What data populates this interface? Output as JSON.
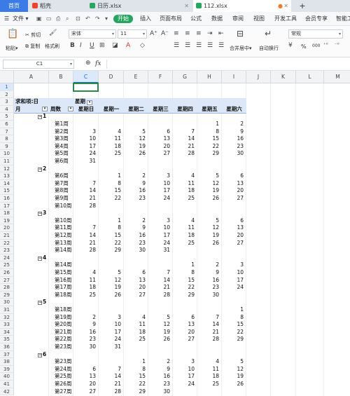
{
  "tabs": {
    "home": "首页",
    "tab1": "稻壳",
    "tab2": "日历.xlsx",
    "tab3": "112.xlsx",
    "new": "+"
  },
  "menu": {
    "file": "文件",
    "items": [
      "开始",
      "插入",
      "页面布局",
      "公式",
      "数据",
      "审阅",
      "视图",
      "开发工具",
      "会员专享",
      "智能工"
    ]
  },
  "ribbon": {
    "paste": "粘贴",
    "cut": "剪切",
    "copy": "复制",
    "format_painter": "格式刷",
    "font_name": "宋体",
    "font_size": "11",
    "merge_center": "合并居中",
    "wrap_text": "自动换行",
    "number_format": "常规",
    "percent": "%",
    "thousands": "000"
  },
  "formula_bar": {
    "cell_ref": "C1",
    "fx": "fx",
    "value": ""
  },
  "columns": [
    "A",
    "B",
    "C",
    "D",
    "E",
    "F",
    "G",
    "H",
    "I",
    "J",
    "K",
    "L",
    "M"
  ],
  "selected_column": "C",
  "selected_row": "1",
  "pivot": {
    "summary_label": "求和项:日",
    "col_field": "星期",
    "row_field_month": "月",
    "row_field_week": "周数",
    "weekdays": [
      "星期日",
      "星期一",
      "星期二",
      "星期三",
      "星期四",
      "星期五",
      "星期六"
    ]
  },
  "rows": [
    {
      "r": "1"
    },
    {
      "r": "2"
    },
    {
      "r": "3",
      "type": "summary"
    },
    {
      "r": "4",
      "type": "header"
    },
    {
      "r": "5",
      "type": "month",
      "month": "1"
    },
    {
      "r": "6",
      "week": "第1周",
      "vals": [
        "",
        "",
        "",
        "",
        "",
        "1",
        "2"
      ]
    },
    {
      "r": "7",
      "week": "第2周",
      "vals": [
        "3",
        "4",
        "5",
        "6",
        "7",
        "8",
        "9"
      ]
    },
    {
      "r": "8",
      "week": "第3周",
      "vals": [
        "10",
        "11",
        "12",
        "13",
        "14",
        "15",
        "16"
      ]
    },
    {
      "r": "9",
      "week": "第4周",
      "vals": [
        "17",
        "18",
        "19",
        "20",
        "21",
        "22",
        "23"
      ]
    },
    {
      "r": "10",
      "week": "第5周",
      "vals": [
        "24",
        "25",
        "26",
        "27",
        "28",
        "29",
        "30"
      ]
    },
    {
      "r": "11",
      "week": "第6周",
      "vals": [
        "31",
        "",
        "",
        "",
        "",
        "",
        ""
      ]
    },
    {
      "r": "12",
      "type": "month",
      "month": "2"
    },
    {
      "r": "13",
      "week": "第6周",
      "vals": [
        "",
        "1",
        "2",
        "3",
        "4",
        "5",
        "6"
      ]
    },
    {
      "r": "14",
      "week": "第7周",
      "vals": [
        "7",
        "8",
        "9",
        "10",
        "11",
        "12",
        "13"
      ]
    },
    {
      "r": "15",
      "week": "第8周",
      "vals": [
        "14",
        "15",
        "16",
        "17",
        "18",
        "19",
        "20"
      ]
    },
    {
      "r": "16",
      "week": "第9周",
      "vals": [
        "21",
        "22",
        "23",
        "24",
        "25",
        "26",
        "27"
      ]
    },
    {
      "r": "17",
      "week": "第10周",
      "vals": [
        "28",
        "",
        "",
        "",
        "",
        "",
        ""
      ]
    },
    {
      "r": "18",
      "type": "month",
      "month": "3"
    },
    {
      "r": "19",
      "week": "第10周",
      "vals": [
        "",
        "1",
        "2",
        "3",
        "4",
        "5",
        "6"
      ]
    },
    {
      "r": "20",
      "week": "第11周",
      "vals": [
        "7",
        "8",
        "9",
        "10",
        "11",
        "12",
        "13"
      ]
    },
    {
      "r": "21",
      "week": "第12周",
      "vals": [
        "14",
        "15",
        "16",
        "17",
        "18",
        "19",
        "20"
      ]
    },
    {
      "r": "22",
      "week": "第13周",
      "vals": [
        "21",
        "22",
        "23",
        "24",
        "25",
        "26",
        "27"
      ]
    },
    {
      "r": "23",
      "week": "第14周",
      "vals": [
        "28",
        "29",
        "30",
        "31",
        "",
        "",
        ""
      ]
    },
    {
      "r": "24",
      "type": "month",
      "month": "4"
    },
    {
      "r": "25",
      "week": "第14周",
      "vals": [
        "",
        "",
        "",
        "",
        "1",
        "2",
        "3"
      ]
    },
    {
      "r": "26",
      "week": "第15周",
      "vals": [
        "4",
        "5",
        "6",
        "7",
        "8",
        "9",
        "10"
      ]
    },
    {
      "r": "27",
      "week": "第16周",
      "vals": [
        "11",
        "12",
        "13",
        "14",
        "15",
        "16",
        "17"
      ]
    },
    {
      "r": "28",
      "week": "第17周",
      "vals": [
        "18",
        "19",
        "20",
        "21",
        "22",
        "23",
        "24"
      ]
    },
    {
      "r": "29",
      "week": "第18周",
      "vals": [
        "25",
        "26",
        "27",
        "28",
        "29",
        "30",
        ""
      ]
    },
    {
      "r": "30",
      "type": "month",
      "month": "5"
    },
    {
      "r": "31",
      "week": "第18周",
      "vals": [
        "",
        "",
        "",
        "",
        "",
        "",
        "1"
      ]
    },
    {
      "r": "32",
      "week": "第19周",
      "vals": [
        "2",
        "3",
        "4",
        "5",
        "6",
        "7",
        "8"
      ]
    },
    {
      "r": "33",
      "week": "第20周",
      "vals": [
        "9",
        "10",
        "11",
        "12",
        "13",
        "14",
        "15"
      ]
    },
    {
      "r": "34",
      "week": "第21周",
      "vals": [
        "16",
        "17",
        "18",
        "19",
        "20",
        "21",
        "22"
      ]
    },
    {
      "r": "35",
      "week": "第22周",
      "vals": [
        "23",
        "24",
        "25",
        "26",
        "27",
        "28",
        "29"
      ]
    },
    {
      "r": "36",
      "week": "第23周",
      "vals": [
        "30",
        "31",
        "",
        "",
        "",
        "",
        ""
      ]
    },
    {
      "r": "37",
      "type": "month",
      "month": "6"
    },
    {
      "r": "38",
      "week": "第23周",
      "vals": [
        "",
        "",
        "1",
        "2",
        "3",
        "4",
        "5"
      ]
    },
    {
      "r": "39",
      "week": "第24周",
      "vals": [
        "6",
        "7",
        "8",
        "9",
        "10",
        "11",
        "12"
      ]
    },
    {
      "r": "40",
      "week": "第25周",
      "vals": [
        "13",
        "14",
        "15",
        "16",
        "17",
        "18",
        "19"
      ]
    },
    {
      "r": "41",
      "week": "第26周",
      "vals": [
        "20",
        "21",
        "22",
        "23",
        "24",
        "25",
        "26"
      ]
    },
    {
      "r": "42",
      "week": "第27周",
      "vals": [
        "27",
        "28",
        "29",
        "30",
        "",
        "",
        ""
      ]
    }
  ]
}
